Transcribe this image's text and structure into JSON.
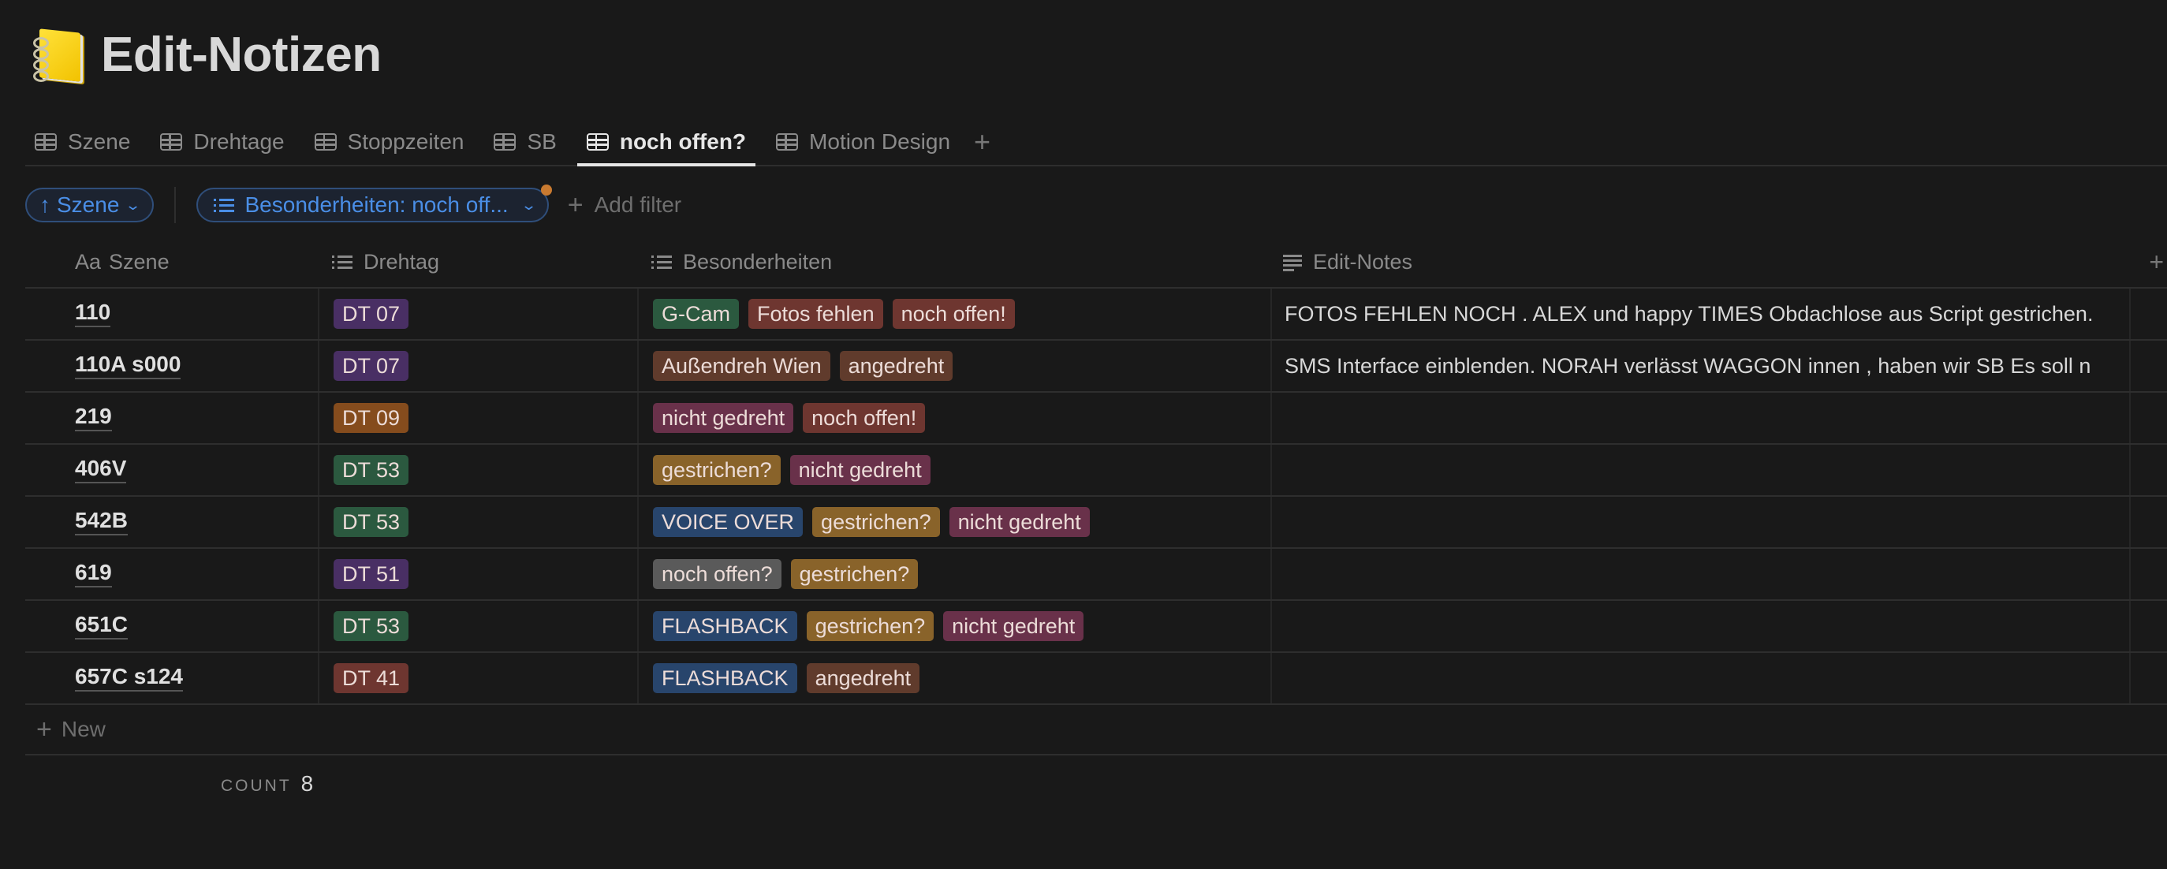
{
  "page": {
    "icon": "spiral-notebook-icon",
    "title": "Edit-Notizen"
  },
  "tabs": [
    {
      "label": "Szene",
      "icon": "table-icon",
      "active": false
    },
    {
      "label": "Drehtage",
      "icon": "table-icon",
      "active": false
    },
    {
      "label": "Stoppzeiten",
      "icon": "table-icon",
      "active": false
    },
    {
      "label": "SB",
      "icon": "table-icon",
      "active": false
    },
    {
      "label": "noch offen?",
      "icon": "table-icon",
      "active": true
    },
    {
      "label": "Motion Design",
      "icon": "table-icon",
      "active": false
    }
  ],
  "tab_add": "+",
  "filters": {
    "sort": {
      "arrow": "↑",
      "label": "Szene",
      "chevron": "⌄"
    },
    "filter": {
      "label": "Besonderheiten: noch off...",
      "chevron": "⌄"
    },
    "add_filter": "Add filter"
  },
  "columns": [
    {
      "prefix": "Aa",
      "label": "Szene",
      "icon": "title-icon"
    },
    {
      "label": "Drehtag",
      "icon": "multi-select-icon"
    },
    {
      "label": "Besonderheiten",
      "icon": "multi-select-icon"
    },
    {
      "label": "Edit-Notes",
      "icon": "text-icon"
    }
  ],
  "add_column": "+",
  "tag_colors": {
    "purple": "#492f64",
    "orange": "#854c1d",
    "green": "#2b593f",
    "red": "#6e3630",
    "brown": "#603b2c",
    "pink": "#69314a",
    "yellow": "#89632a",
    "blue": "#28456c",
    "gray": "#5a5a5a"
  },
  "rows": [
    {
      "szene": "110",
      "drehtag": {
        "label": "DT 07",
        "color": "purple"
      },
      "besonderheiten": [
        {
          "label": "G-Cam",
          "color": "green"
        },
        {
          "label": "Fotos fehlen",
          "color": "red"
        },
        {
          "label": "noch offen!",
          "color": "red"
        }
      ],
      "notes": "FOTOS FEHLEN NOCH . ALEX und happy TIMES Obdachlose aus Script gestrichen."
    },
    {
      "szene": "110A s000",
      "drehtag": {
        "label": "DT 07",
        "color": "purple"
      },
      "besonderheiten": [
        {
          "label": "Außendreh Wien",
          "color": "brown"
        },
        {
          "label": "angedreht",
          "color": "brown"
        }
      ],
      "notes": "SMS Interface einblenden. NORAH verlässt WAGGON innen , haben wir SB Es soll n"
    },
    {
      "szene": "219",
      "drehtag": {
        "label": "DT 09",
        "color": "orange"
      },
      "besonderheiten": [
        {
          "label": "nicht gedreht",
          "color": "pink"
        },
        {
          "label": "noch offen!",
          "color": "red"
        }
      ],
      "notes": ""
    },
    {
      "szene": "406V",
      "drehtag": {
        "label": "DT 53",
        "color": "green"
      },
      "besonderheiten": [
        {
          "label": "gestrichen?",
          "color": "yellow"
        },
        {
          "label": "nicht gedreht",
          "color": "pink"
        }
      ],
      "notes": ""
    },
    {
      "szene": "542B",
      "drehtag": {
        "label": "DT 53",
        "color": "green"
      },
      "besonderheiten": [
        {
          "label": "VOICE OVER",
          "color": "blue"
        },
        {
          "label": "gestrichen?",
          "color": "yellow"
        },
        {
          "label": "nicht gedreht",
          "color": "pink"
        }
      ],
      "notes": ""
    },
    {
      "szene": "619",
      "drehtag": {
        "label": "DT 51",
        "color": "purple"
      },
      "besonderheiten": [
        {
          "label": "noch offen?",
          "color": "gray"
        },
        {
          "label": "gestrichen?",
          "color": "yellow"
        }
      ],
      "notes": ""
    },
    {
      "szene": "651C",
      "drehtag": {
        "label": "DT 53",
        "color": "green"
      },
      "besonderheiten": [
        {
          "label": "FLASHBACK",
          "color": "blue"
        },
        {
          "label": "gestrichen?",
          "color": "yellow"
        },
        {
          "label": "nicht gedreht",
          "color": "pink"
        }
      ],
      "notes": ""
    },
    {
      "szene": "657C s124",
      "drehtag": {
        "label": "DT 41",
        "color": "red"
      },
      "besonderheiten": [
        {
          "label": "FLASHBACK",
          "color": "blue"
        },
        {
          "label": "angedreht",
          "color": "brown"
        }
      ],
      "notes": ""
    }
  ],
  "new_row": {
    "plus": "+",
    "label": "New"
  },
  "footer": {
    "count_label": "COUNT",
    "count_value": "8"
  },
  "colors": {
    "background": "#191919",
    "accent_blue": "#4a8ee6",
    "filter_dot": "#c97a30"
  }
}
